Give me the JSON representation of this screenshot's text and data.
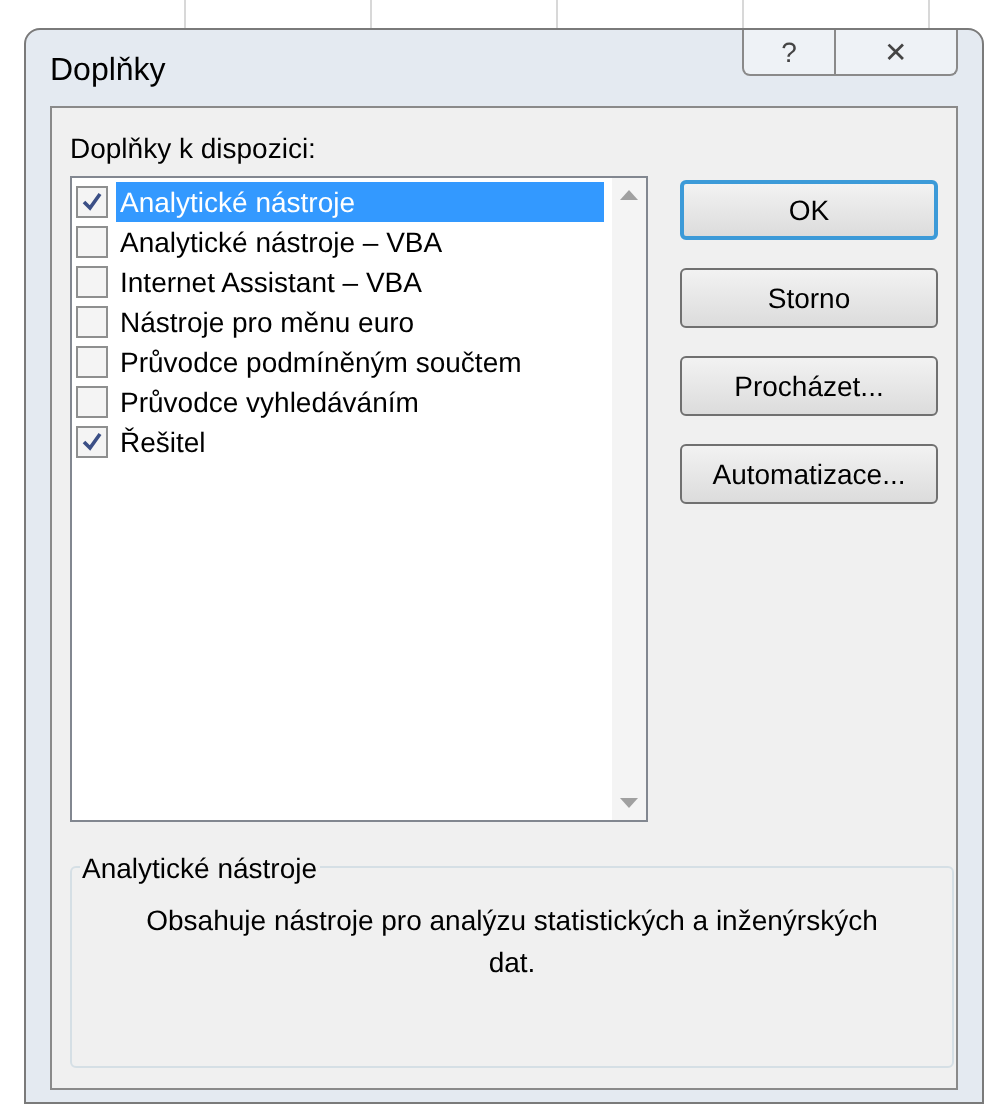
{
  "window": {
    "title": "Doplňky",
    "title_buttons": [
      "?",
      "✕"
    ]
  },
  "list_label": "Doplňky k dispozici:",
  "items": [
    {
      "label": "Analytické nástroje",
      "checked": true,
      "selected": true
    },
    {
      "label": "Analytické nástroje – VBA",
      "checked": false,
      "selected": false
    },
    {
      "label": "Internet Assistant – VBA",
      "checked": false,
      "selected": false
    },
    {
      "label": "Nástroje pro měnu euro",
      "checked": false,
      "selected": false
    },
    {
      "label": "Průvodce podmíněným součtem",
      "checked": false,
      "selected": false
    },
    {
      "label": "Průvodce vyhledáváním",
      "checked": false,
      "selected": false
    },
    {
      "label": "Řešitel",
      "checked": true,
      "selected": false
    }
  ],
  "buttons": [
    {
      "label": "OK",
      "default": true
    },
    {
      "label": "Storno",
      "default": false
    },
    {
      "label": "Procházet...",
      "default": false
    },
    {
      "label": "Automatizace...",
      "default": false
    }
  ],
  "description": {
    "title": "Analytické nástroje",
    "text": "Obsahuje nástroje pro analýzu statistických a inženýrských dat."
  }
}
